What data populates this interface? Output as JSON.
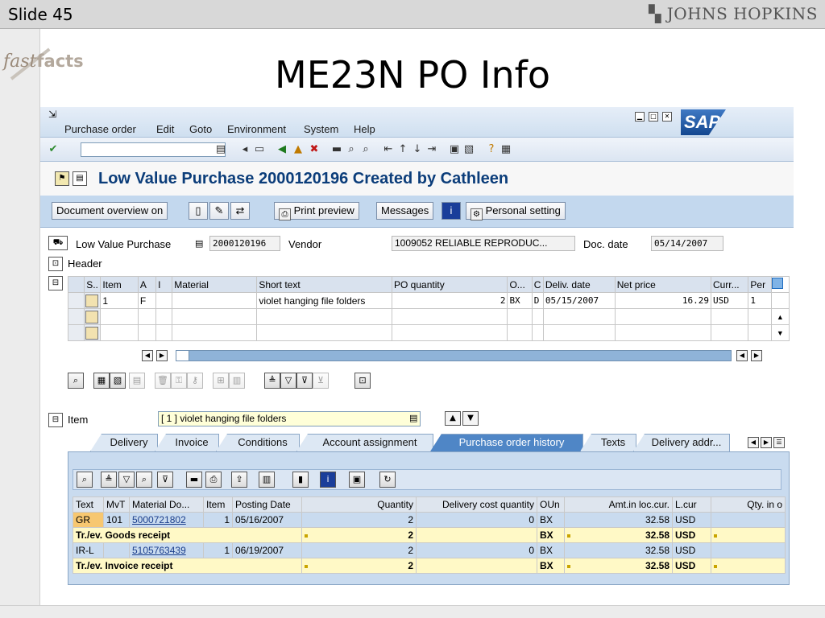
{
  "slide": {
    "number": "Slide 45",
    "org": "JOHNS HOPKINS",
    "fastfacts_a": "fast",
    "fastfacts_b": "facts",
    "title": "ME23N PO Info"
  },
  "sap": {
    "menu": [
      "Purchase order",
      "Edit",
      "Goto",
      "Environment",
      "System",
      "Help"
    ],
    "logo": "SAP",
    "command_field": "",
    "screen_title": "Low Value Purchase 2000120196 Created by Cathleen",
    "app_toolbar": {
      "doc_overview": "Document overview on",
      "print_preview": "Print preview",
      "messages": "Messages",
      "personal_setting": "Personal setting"
    },
    "header_fields": {
      "doc_type": "Low Value Purchase",
      "po_number": "2000120196",
      "vendor_label": "Vendor",
      "vendor_value": "1009052 RELIABLE REPRODUC...",
      "doc_date_label": "Doc. date",
      "doc_date_value": "05/14/2007",
      "header_label": "Header"
    },
    "item_table": {
      "columns": [
        "S..",
        "Item",
        "A",
        "I",
        "Material",
        "Short text",
        "PO quantity",
        "O...",
        "C",
        "Deliv. date",
        "Net price",
        "Curr...",
        "Per"
      ],
      "rows": [
        {
          "item": "1",
          "a": "F",
          "i": "",
          "material": "",
          "short_text": "violet hanging file folders",
          "qty": "2",
          "unit": "BX",
          "c": "D",
          "deliv_date": "05/15/2007",
          "net_price": "16.29",
          "curr": "USD",
          "per": "1"
        }
      ]
    },
    "item_section": {
      "label": "Item",
      "selected": "[ 1 ] violet hanging file folders"
    },
    "tabs": [
      "Delivery",
      "Invoice",
      "Conditions",
      "Account assignment",
      "Purchase order history",
      "Texts",
      "Delivery addr..."
    ],
    "active_tab": "Purchase order history",
    "history": {
      "columns": [
        "Text",
        "MvT",
        "Material Do...",
        "Item",
        "Posting Date",
        "Quantity",
        "Delivery cost quantity",
        "OUn",
        "Amt.in loc.cur.",
        "L.cur",
        "Qty. in o"
      ],
      "rows": [
        {
          "text": "GR",
          "mvt": "101",
          "doc": "5000721802",
          "item": "1",
          "date": "05/16/2007",
          "qty": "2",
          "dcq": "0",
          "oun": "BX",
          "amt": "32.58",
          "cur": "USD"
        },
        {
          "text": "Tr./ev. Goods receipt",
          "qty": "2",
          "oun": "BX",
          "amt": "32.58",
          "cur": "USD"
        },
        {
          "text": "IR-L",
          "mvt": "",
          "doc": "5105763439",
          "item": "1",
          "date": "06/19/2007",
          "qty": "2",
          "dcq": "0",
          "oun": "BX",
          "amt": "32.58",
          "cur": "USD"
        },
        {
          "text": "Tr./ev. Invoice receipt",
          "qty": "2",
          "oun": "BX",
          "amt": "32.58",
          "cur": "USD"
        }
      ]
    }
  },
  "colors": {
    "sap_blue": "#0b3d7a",
    "toolbar": "#c3d8ee",
    "active_tab": "#4f86c6",
    "sum_row": "#fff9c6",
    "gr_cell": "#f7c770"
  }
}
